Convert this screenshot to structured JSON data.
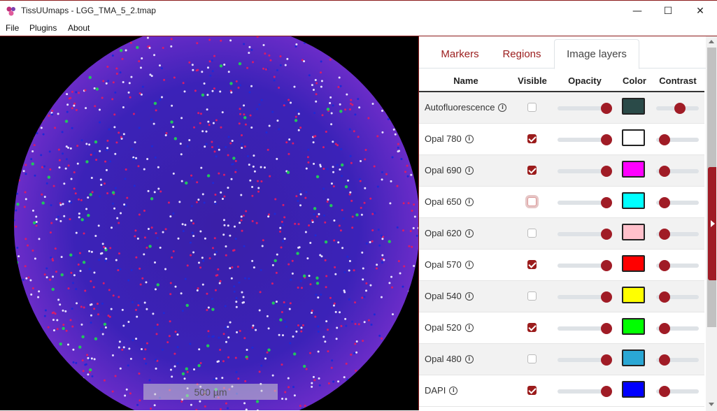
{
  "window": {
    "title": "TissUUmaps - LGG_TMA_5_2.tmap",
    "minimize": "—",
    "maximize": "☐",
    "close": "✕"
  },
  "menu": [
    "File",
    "Plugins",
    "About"
  ],
  "viewer": {
    "scalebar_label": "500 µm"
  },
  "tabs": [
    {
      "label": "Markers",
      "active": false
    },
    {
      "label": "Regions",
      "active": false
    },
    {
      "label": "Image layers",
      "active": true
    }
  ],
  "table": {
    "headers": [
      "Name",
      "Visible",
      "Opacity",
      "Color",
      "Contrast"
    ],
    "rows": [
      {
        "name": "Autofluorescence",
        "visible": false,
        "opacity": 1.0,
        "color": "#2a4a48",
        "contrast": 0.55
      },
      {
        "name": "Opal 780",
        "visible": true,
        "opacity": 1.0,
        "color": "#ffffff",
        "contrast": 0.2
      },
      {
        "name": "Opal 690",
        "visible": true,
        "opacity": 1.0,
        "color": "#ff00ff",
        "contrast": 0.2
      },
      {
        "name": "Opal 650",
        "visible": false,
        "opacity": 1.0,
        "color": "#00ffff",
        "contrast": 0.2
      },
      {
        "name": "Opal 620",
        "visible": false,
        "opacity": 1.0,
        "color": "#ffc0cb",
        "contrast": 0.2
      },
      {
        "name": "Opal 570",
        "visible": true,
        "opacity": 1.0,
        "color": "#ff0000",
        "contrast": 0.2
      },
      {
        "name": "Opal 540",
        "visible": false,
        "opacity": 1.0,
        "color": "#ffff00",
        "contrast": 0.2
      },
      {
        "name": "Opal 520",
        "visible": true,
        "opacity": 1.0,
        "color": "#00ff00",
        "contrast": 0.2
      },
      {
        "name": "Opal 480",
        "visible": false,
        "opacity": 1.0,
        "color": "#2aa7d4",
        "contrast": 0.2
      },
      {
        "name": "DAPI",
        "visible": true,
        "opacity": 1.0,
        "color": "#0000ff",
        "contrast": 0.2
      }
    ]
  },
  "colors": {
    "accent": "#a01c26",
    "tissue_background": "#000000"
  }
}
